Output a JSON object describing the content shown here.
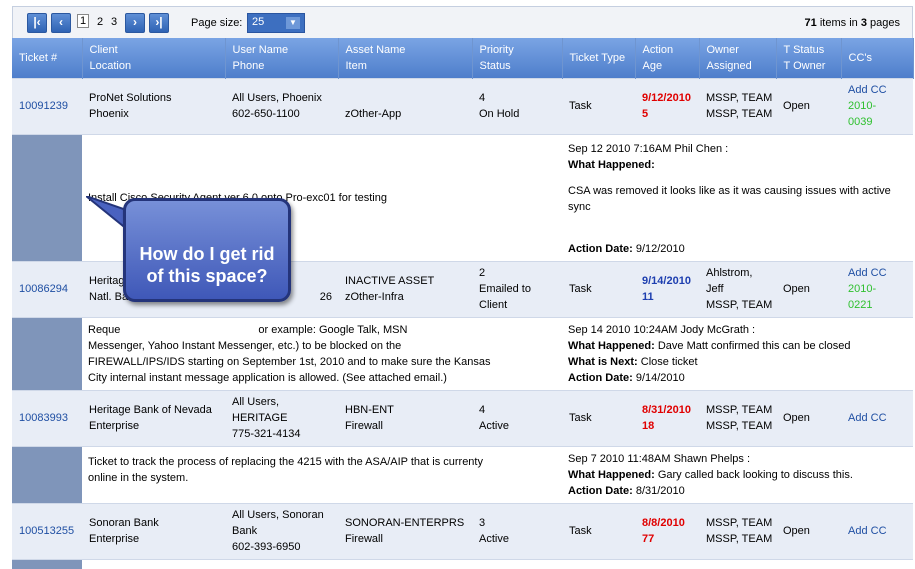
{
  "pager": {
    "first_icon": "first-page-icon",
    "prev_icon": "prev-page-icon",
    "next_icon": "next-page-icon",
    "last_icon": "last-page-icon",
    "pages": [
      "1",
      "2",
      "3"
    ],
    "page_size_label": "Page size:",
    "page_size_value": "25",
    "items_count": "71",
    "items_text": "items in",
    "pages_count": "3",
    "pages_text": "pages"
  },
  "columns": [
    {
      "top": "",
      "bottom": "Ticket #"
    },
    {
      "top": "Client",
      "bottom": "Location"
    },
    {
      "top": "User Name",
      "bottom": "Phone"
    },
    {
      "top": "Asset Name",
      "bottom": "Item"
    },
    {
      "top": "Priority",
      "bottom": "Status"
    },
    {
      "top": "",
      "bottom": "Ticket Type"
    },
    {
      "top": "Action",
      "bottom": "Age"
    },
    {
      "top": "Owner",
      "bottom": "Assigned"
    },
    {
      "top": "T Status",
      "bottom": "T Owner"
    },
    {
      "top": "",
      "bottom": "CC's"
    }
  ],
  "tickets": [
    {
      "id": "10091239",
      "client": "ProNet Solutions",
      "location": "Phoenix",
      "user": "All Users, Phoenix",
      "phone": "602-650-1100",
      "asset": "",
      "item": "zOther-App",
      "priority": "4",
      "status": "On Hold",
      "type": "Task",
      "action": "9/12/2010",
      "age": "5",
      "action_color": "red",
      "owner1": "MSSP, TEAM",
      "owner2": "MSSP, TEAM",
      "tstatus": "Open",
      "cc": "Add CC",
      "cc_num1": "2010-",
      "cc_num2": "0039",
      "desc": "Install Cisco Security Agent ver 6.0 onto Pro-exc01 for testing",
      "note_header": "Sep 12 2010 7:16AM Phil Chen :",
      "what_label": "What Happened:",
      "what": "",
      "body": "CSA was removed it looks like as it was causing issues with active sync",
      "next_label": "",
      "next": "",
      "date_label": "Action Date:",
      "date": "9/12/2010"
    },
    {
      "id": "10086294",
      "client": "Heritag",
      "location": "Natl. Ba",
      "user": "",
      "phone": "26",
      "asset": "INACTIVE ASSET",
      "item": "zOther-Infra",
      "priority": "2",
      "status": "Emailed to Client",
      "type": "Task",
      "action": "9/14/2010",
      "age": "11",
      "action_color": "blue",
      "owner1": "Ahlstrom,",
      "owner2": "Jeff",
      "owner3": "MSSP, TEAM",
      "tstatus": "Open",
      "cc": "Add CC",
      "cc_num1": "2010-",
      "cc_num2": "0221",
      "desc_l1": "Reque",
      "desc_l1b": "or example: Google Talk, MSN",
      "desc_l2": "Messenger, Yahoo Instant Messenger, etc.) to be blocked on the",
      "desc_l3": "FIREWALL/IPS/IDS starting on September 1st, 2010 and to make sure the Kansas",
      "desc_l4": "City internal instant message application is allowed. (See attached email.)",
      "note_header": "Sep 14 2010 10:24AM Jody McGrath :",
      "what_label": "What Happened:",
      "what": "Dave Matt confirmed this can be closed",
      "next_label": "What is Next:",
      "next": "Close ticket",
      "date_label": "Action Date:",
      "date": "9/14/2010"
    },
    {
      "id": "10083993",
      "client": "Heritage Bank of Nevada",
      "location": "Enterprise",
      "user1": "All Users,",
      "user2": "HERITAGE",
      "phone": "775-321-4134",
      "asset": "HBN-ENT",
      "item": "Firewall",
      "priority": "4",
      "status": "Active",
      "type": "Task",
      "action": "8/31/2010",
      "age": "18",
      "action_color": "red",
      "owner1": "MSSP, TEAM",
      "owner2": "MSSP, TEAM",
      "tstatus": "Open",
      "cc": "Add CC",
      "desc_l1": "Ticket to track the process of replacing the 4215 with the ASA/AIP that is currenty",
      "desc_l2": "online in the system.",
      "note_header": "Sep 7 2010 11:48AM Shawn Phelps :",
      "what_label": "What Happened:",
      "what": "Gary called back looking to discuss this.",
      "date_label": "Action Date:",
      "date": "8/31/2010"
    },
    {
      "id": "100513255",
      "client": "Sonoran Bank",
      "location": "Enterprise",
      "user1": "All Users, Sonoran",
      "user2": "Bank",
      "phone": "602-393-6950",
      "asset": "SONORAN-ENTERPRS",
      "item": "Firewall",
      "priority": "3",
      "status": "Active",
      "type": "Task",
      "action": "8/8/2010",
      "age": "77",
      "action_color": "red",
      "owner1": "MSSP, TEAM",
      "owner2": "MSSP, TEAM",
      "tstatus": "Open",
      "cc": "Add CC"
    }
  ],
  "callout": {
    "line1": "How do I get rid",
    "line2": "of this space?"
  }
}
